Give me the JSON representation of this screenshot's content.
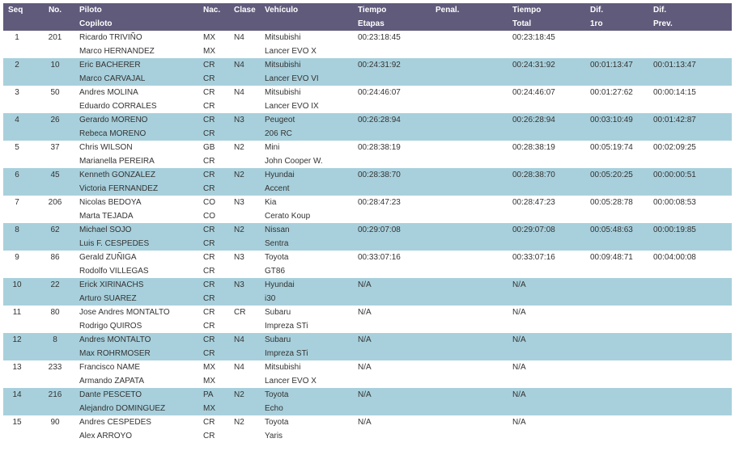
{
  "headers": {
    "seq": "Seq",
    "no": "No.",
    "piloto": "Piloto",
    "copiloto": "Copiloto",
    "nac": "Nac.",
    "clase": "Clase",
    "vehiculo": "Vehículo",
    "tiempo_etapas_1": "Tiempo",
    "tiempo_etapas_2": "Etapas",
    "penal": "Penal.",
    "tiempo_total_1": "Tiempo",
    "tiempo_total_2": "Total",
    "dif1ro_1": "Dif.",
    "dif1ro_2": "1ro",
    "difprev_1": "Dif.",
    "difprev_2": "Prev."
  },
  "rows": [
    {
      "seq": "1",
      "no": "201",
      "pilot": "Ricardo TRIVIÑO",
      "copilot": "Marco HERNANDEZ",
      "nac1": "MX",
      "nac2": "MX",
      "clase": "N4",
      "make": "Mitsubishi",
      "model": "Lancer EVO X",
      "etapas": "00:23:18:45",
      "penal": "",
      "total": "00:23:18:45",
      "dif1ro": "",
      "difprev": ""
    },
    {
      "seq": "2",
      "no": "10",
      "pilot": "Eric BACHERER",
      "copilot": "Marco CARVAJAL",
      "nac1": "CR",
      "nac2": "CR",
      "clase": "N4",
      "make": "Mitsubishi",
      "model": "Lancer EVO VI",
      "etapas": "00:24:31:92",
      "penal": "",
      "total": "00:24:31:92",
      "dif1ro": "00:01:13:47",
      "difprev": "00:01:13:47"
    },
    {
      "seq": "3",
      "no": "50",
      "pilot": "Andres MOLINA",
      "copilot": "Eduardo CORRALES",
      "nac1": "CR",
      "nac2": "CR",
      "clase": "N4",
      "make": "Mitsubishi",
      "model": "Lancer EVO IX",
      "etapas": "00:24:46:07",
      "penal": "",
      "total": "00:24:46:07",
      "dif1ro": "00:01:27:62",
      "difprev": "00:00:14:15"
    },
    {
      "seq": "4",
      "no": "26",
      "pilot": "Gerardo MORENO",
      "copilot": "Rebeca MORENO",
      "nac1": "CR",
      "nac2": "CR",
      "clase": "N3",
      "make": "Peugeot",
      "model": "206 RC",
      "etapas": "00:26:28:94",
      "penal": "",
      "total": "00:26:28:94",
      "dif1ro": "00:03:10:49",
      "difprev": "00:01:42:87"
    },
    {
      "seq": "5",
      "no": "37",
      "pilot": "Chris WILSON",
      "copilot": "Marianella PEREIRA",
      "nac1": "GB",
      "nac2": "CR",
      "clase": "N2",
      "make": "Mini",
      "model": "John Cooper W.",
      "etapas": "00:28:38:19",
      "penal": "",
      "total": "00:28:38:19",
      "dif1ro": "00:05:19:74",
      "difprev": "00:02:09:25"
    },
    {
      "seq": "6",
      "no": "45",
      "pilot": "Kenneth GONZALEZ",
      "copilot": "Victoria FERNANDEZ",
      "nac1": "CR",
      "nac2": "CR",
      "clase": "N2",
      "make": "Hyundai",
      "model": "Accent",
      "etapas": "00:28:38:70",
      "penal": "",
      "total": "00:28:38:70",
      "dif1ro": "00:05:20:25",
      "difprev": "00:00:00:51"
    },
    {
      "seq": "7",
      "no": "206",
      "pilot": "Nicolas BEDOYA",
      "copilot": "Marta TEJADA",
      "nac1": "CO",
      "nac2": "CO",
      "clase": "N3",
      "make": "Kia",
      "model": "Cerato Koup",
      "etapas": "00:28:47:23",
      "penal": "",
      "total": "00:28:47:23",
      "dif1ro": "00:05:28:78",
      "difprev": "00:00:08:53"
    },
    {
      "seq": "8",
      "no": "62",
      "pilot": "Michael SOJO",
      "copilot": "Luis F. CESPEDES",
      "nac1": "CR",
      "nac2": "CR",
      "clase": "N2",
      "make": "Nissan",
      "model": "Sentra",
      "etapas": "00:29:07:08",
      "penal": "",
      "total": "00:29:07:08",
      "dif1ro": "00:05:48:63",
      "difprev": "00:00:19:85"
    },
    {
      "seq": "9",
      "no": "86",
      "pilot": "Gerald ZUÑIGA",
      "copilot": "Rodolfo VILLEGAS",
      "nac1": "CR",
      "nac2": "CR",
      "clase": "N3",
      "make": "Toyota",
      "model": "GT86",
      "etapas": "00:33:07:16",
      "penal": "",
      "total": "00:33:07:16",
      "dif1ro": "00:09:48:71",
      "difprev": "00:04:00:08"
    },
    {
      "seq": "10",
      "no": "22",
      "pilot": "Erick XIRINACHS",
      "copilot": "Arturo SUAREZ",
      "nac1": "CR",
      "nac2": "CR",
      "clase": "N3",
      "make": "Hyundai",
      "model": "i30",
      "etapas": "N/A",
      "penal": "",
      "total": "N/A",
      "dif1ro": "",
      "difprev": ""
    },
    {
      "seq": "11",
      "no": "80",
      "pilot": "Jose Andres MONTALTO",
      "copilot": "Rodrigo QUIROS",
      "nac1": "CR",
      "nac2": "CR",
      "clase": "CR",
      "make": "Subaru",
      "model": "Impreza STi",
      "etapas": "N/A",
      "penal": "",
      "total": "N/A",
      "dif1ro": "",
      "difprev": ""
    },
    {
      "seq": "12",
      "no": "8",
      "pilot": "Andres MONTALTO",
      "copilot": "Max ROHRMOSER",
      "nac1": "CR",
      "nac2": "CR",
      "clase": "N4",
      "make": "Subaru",
      "model": "Impreza STi",
      "etapas": "N/A",
      "penal": "",
      "total": "N/A",
      "dif1ro": "",
      "difprev": ""
    },
    {
      "seq": "13",
      "no": "233",
      "pilot": "Francisco NAME",
      "copilot": "Armando ZAPATA",
      "nac1": "MX",
      "nac2": "MX",
      "clase": "N4",
      "make": "Mitsubishi",
      "model": "Lancer EVO X",
      "etapas": "N/A",
      "penal": "",
      "total": "N/A",
      "dif1ro": "",
      "difprev": ""
    },
    {
      "seq": "14",
      "no": "216",
      "pilot": "Dante PESCETO",
      "copilot": "Alejandro DOMINGUEZ",
      "nac1": "PA",
      "nac2": "MX",
      "clase": "N2",
      "make": "Toyota",
      "model": "Echo",
      "etapas": "N/A",
      "penal": "",
      "total": "N/A",
      "dif1ro": "",
      "difprev": ""
    },
    {
      "seq": "15",
      "no": "90",
      "pilot": "Andres CESPEDES",
      "copilot": "Alex ARROYO",
      "nac1": "CR",
      "nac2": "CR",
      "clase": "N2",
      "make": "Toyota",
      "model": "Yaris",
      "etapas": "N/A",
      "penal": "",
      "total": "N/A",
      "dif1ro": "",
      "difprev": ""
    }
  ]
}
